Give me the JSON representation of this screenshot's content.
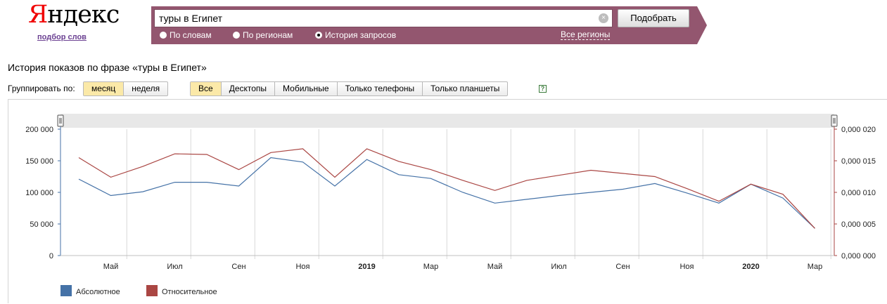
{
  "logo": {
    "first_letter": "Я",
    "rest": "ндекс",
    "subtitle": "подбор слов"
  },
  "search": {
    "value": "туры в Египет",
    "submit_label": "Подобрать"
  },
  "modes": [
    {
      "label": "По словам",
      "selected": false
    },
    {
      "label": "По регионам",
      "selected": false
    },
    {
      "label": "История запросов",
      "selected": true
    }
  ],
  "regions_link": "Все регионы",
  "heading": "История показов по фразе «туры в Египет»",
  "grouping": {
    "label": "Группировать по:",
    "options": [
      {
        "label": "месяц",
        "active": true
      },
      {
        "label": "неделя",
        "active": false
      }
    ]
  },
  "devices": [
    {
      "label": "Все",
      "active": true
    },
    {
      "label": "Десктопы",
      "active": false
    },
    {
      "label": "Мобильные",
      "active": false
    },
    {
      "label": "Только телефоны",
      "active": false
    },
    {
      "label": "Только планшеты",
      "active": false
    }
  ],
  "help_label": "?",
  "chart_data": {
    "type": "line",
    "title": "",
    "x": [
      "2018-04",
      "2018-05",
      "2018-06",
      "2018-07",
      "2018-08",
      "2018-09",
      "2018-10",
      "2018-11",
      "2018-12",
      "2019-01",
      "2019-02",
      "2019-03",
      "2019-04",
      "2019-05",
      "2019-06",
      "2019-07",
      "2019-08",
      "2019-09",
      "2019-10",
      "2019-11",
      "2019-12",
      "2020-01",
      "2020-02",
      "2020-03"
    ],
    "x_tick_labels": [
      {
        "x": "2018-05",
        "label": "Май",
        "bold": false
      },
      {
        "x": "2018-07",
        "label": "Июл",
        "bold": false
      },
      {
        "x": "2018-09",
        "label": "Сен",
        "bold": false
      },
      {
        "x": "2018-11",
        "label": "Ноя",
        "bold": false
      },
      {
        "x": "2019-01",
        "label": "2019",
        "bold": true
      },
      {
        "x": "2019-03",
        "label": "Мар",
        "bold": false
      },
      {
        "x": "2019-05",
        "label": "Май",
        "bold": false
      },
      {
        "x": "2019-07",
        "label": "Июл",
        "bold": false
      },
      {
        "x": "2019-09",
        "label": "Сен",
        "bold": false
      },
      {
        "x": "2019-11",
        "label": "Ноя",
        "bold": false
      },
      {
        "x": "2020-01",
        "label": "2020",
        "bold": true
      },
      {
        "x": "2020-03",
        "label": "Мар",
        "bold": false
      }
    ],
    "y_left": {
      "range": [
        0,
        200000
      ],
      "ticks": [
        0,
        50000,
        100000,
        150000,
        200000
      ],
      "tick_labels": [
        "0",
        "50 000",
        "100 000",
        "150 000",
        "200 000"
      ]
    },
    "y_right": {
      "range": [
        0,
        0.02
      ],
      "ticks": [
        0,
        0.005,
        0.01,
        0.015,
        0.02
      ],
      "tick_labels": [
        "0,000 000",
        "0,000 005",
        "0,000 010",
        "0,000 015",
        "0,000 020"
      ]
    },
    "series": [
      {
        "name": "Абсолютное",
        "axis": "left",
        "color": "#4572a7",
        "values": [
          121000,
          95000,
          101000,
          116000,
          116000,
          110000,
          155000,
          148000,
          110000,
          152000,
          128000,
          122000,
          100000,
          83000,
          89000,
          95000,
          100000,
          105000,
          114000,
          99000,
          83000,
          113000,
          91000,
          43000
        ]
      },
      {
        "name": "Относительное",
        "axis": "right",
        "color": "#aa4643",
        "values": [
          0.0155,
          0.0124,
          0.0141,
          0.0161,
          0.016,
          0.0136,
          0.0163,
          0.0169,
          0.0124,
          0.0169,
          0.0149,
          0.0136,
          0.0119,
          0.0103,
          0.0119,
          0.0127,
          0.0135,
          0.013,
          0.0125,
          0.0106,
          0.0086,
          0.0113,
          0.0097,
          0.0043
        ]
      }
    ],
    "grid": true,
    "legend": "bottom-left",
    "colors": {
      "grid": "#d8d8d8",
      "navigator": "#e8e8e8",
      "axis": "#4572a7",
      "axis_right": "#aa4643"
    }
  }
}
